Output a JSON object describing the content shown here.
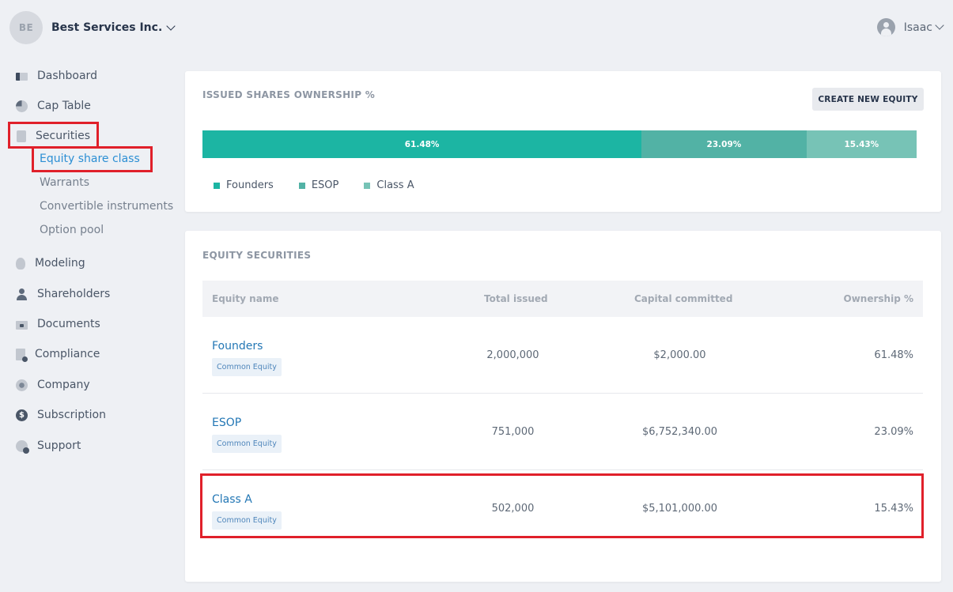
{
  "header": {
    "company_initials": "BE",
    "company_name": "Best Services Inc.",
    "user_name": "Isaac"
  },
  "sidebar": {
    "items": [
      {
        "label": "Dashboard",
        "icon": "dashboard-icon"
      },
      {
        "label": "Cap Table",
        "icon": "pie-chart-icon"
      },
      {
        "label": "Securities",
        "icon": "clipboard-icon"
      },
      {
        "label": "Modeling",
        "icon": "lightbulb-icon"
      },
      {
        "label": "Shareholders",
        "icon": "person-icon"
      },
      {
        "label": "Documents",
        "icon": "folder-lock-icon"
      },
      {
        "label": "Compliance",
        "icon": "document-check-icon"
      },
      {
        "label": "Company",
        "icon": "flower-icon"
      },
      {
        "label": "Subscription",
        "icon": "dollar-icon"
      },
      {
        "label": "Support",
        "icon": "support-icon"
      }
    ],
    "securities_sub": [
      {
        "label": "Equity share class",
        "active": true
      },
      {
        "label": "Warrants"
      },
      {
        "label": "Convertible instruments"
      },
      {
        "label": "Option pool"
      }
    ]
  },
  "ownership_card": {
    "title": "ISSUED SHARES OWNERSHIP %",
    "create_button": "CREATE NEW EQUITY",
    "segments": [
      {
        "name": "Founders",
        "percent": 61.48,
        "label": "61.48%",
        "color": "#1cb5a3"
      },
      {
        "name": "ESOP",
        "percent": 23.09,
        "label": "23.09%",
        "color": "#52b2a5"
      },
      {
        "name": "Class A",
        "percent": 15.43,
        "label": "15.43%",
        "color": "#77c3b6"
      }
    ]
  },
  "equity_card": {
    "title": "EQUITY SECURITIES",
    "columns": [
      "Equity name",
      "Total issued",
      "Capital committed",
      "Ownership %"
    ],
    "rows": [
      {
        "name": "Founders",
        "tag": "Common Equity",
        "total": "2,000,000",
        "capital": "$2,000.00",
        "ownership": "61.48%"
      },
      {
        "name": "ESOP",
        "tag": "Common Equity",
        "total": "751,000",
        "capital": "$6,752,340.00",
        "ownership": "23.09%"
      },
      {
        "name": "Class A",
        "tag": "Common Equity",
        "total": "502,000",
        "capital": "$5,101,000.00",
        "ownership": "15.43%"
      }
    ]
  },
  "colors": {
    "accent_link": "#2377b5",
    "active_sub": "#2c8fd4",
    "highlight": "#e0202a"
  }
}
